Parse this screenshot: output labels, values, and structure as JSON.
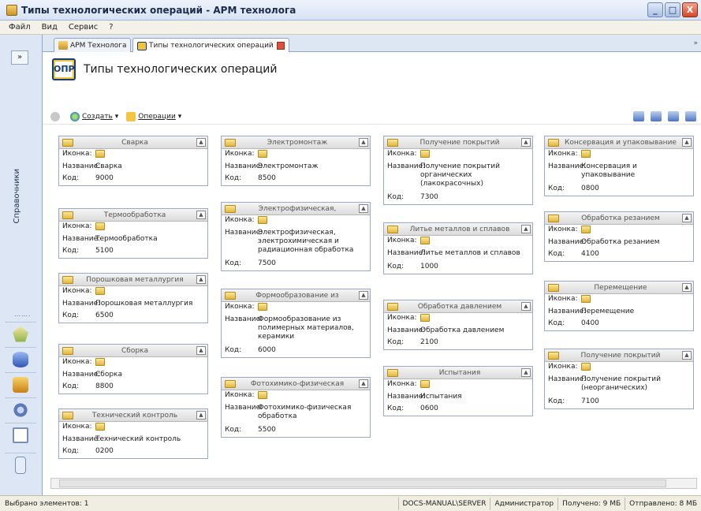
{
  "window": {
    "title": "Типы технологических операций - АРМ технолога",
    "controls": [
      "_",
      "□",
      "X"
    ]
  },
  "menu": [
    "Файл",
    "Вид",
    "Сервис",
    "?"
  ],
  "left_bar": {
    "expand_label": "»",
    "vertical_label": "Справочники",
    "dots": "……."
  },
  "tabs": [
    {
      "label": "АРМ Технолога"
    },
    {
      "label": "Типы технологических операций"
    }
  ],
  "header": {
    "icon_text": "ОПР",
    "title": "Типы технологических операций"
  },
  "toolbar": {
    "create": "Создать",
    "operations": "Операции",
    "dropdown": "▾"
  },
  "field_labels": {
    "icon": "Иконка:",
    "name": "Название:",
    "code": "Код:"
  },
  "cards": [
    {
      "title": "Сварка",
      "name": "Сварка",
      "code": "9000"
    },
    {
      "title": "Термообработка",
      "name": "Термообработка",
      "code": "5100"
    },
    {
      "title": "Порошковая металлургия",
      "name": "Порошковая металлургия",
      "code": "6500"
    },
    {
      "title": "Сборка",
      "name": "Сборка",
      "code": "8800"
    },
    {
      "title": "Технический контроль",
      "name": "Технический контроль",
      "code": "0200"
    },
    {
      "title": "Электромонтаж",
      "name": "Электромонтаж",
      "code": "8500"
    },
    {
      "title": "Электрофизическая,",
      "name": "Электрофизическая, электрохимическая и радиационная обработка",
      "code": "7500"
    },
    {
      "title": "Формообразование из",
      "name": "Формообразование из полимерных материалов, керамики",
      "code": "6000"
    },
    {
      "title": "Фотохимико-физическая",
      "name": "Фотохимико-физическая обработка",
      "code": "5500"
    },
    {
      "title": "Получение покрытий",
      "name": "Получение покрытий органических (лакокрасочных)",
      "code": "7300"
    },
    {
      "title": "Литье металлов и сплавов",
      "name": "Литье металлов и сплавов",
      "code": "1000"
    },
    {
      "title": "Обработка давлением",
      "name": "Обработка давлением",
      "code": "2100"
    },
    {
      "title": "Испытания",
      "name": "Испытания",
      "code": "0600"
    },
    {
      "title": "Консервация и упаковывание",
      "name": "Консервация и упаковывание",
      "code": "0800"
    },
    {
      "title": "Обработка резанием",
      "name": "Обработка резанием",
      "code": "4100"
    },
    {
      "title": "Перемещение",
      "name": "Перемещение",
      "code": "0400"
    },
    {
      "title": "Получение покрытий",
      "name": "Получение покрытий (неорганических)",
      "code": "7100"
    }
  ],
  "status": {
    "selected": "Выбрано элементов: 1",
    "server": "DOCS-MANUAL\\SERVER",
    "user": "Администратор",
    "received": "Получено: 9 МБ",
    "sent": "Отправлено: 8 МБ"
  }
}
